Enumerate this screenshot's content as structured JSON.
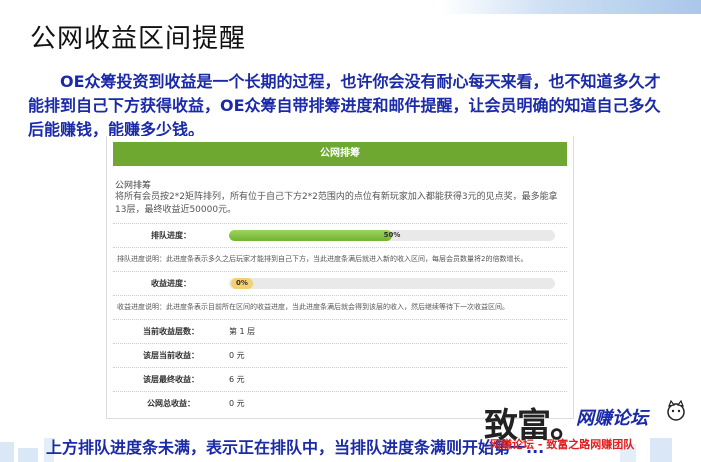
{
  "slide": {
    "title": "公网收益区间提醒",
    "intro": "OE众筹投资到收益是一个长期的过程，也许你会没有耐心每天来看，也不知道多久才能排到自己下方获得收益，OE众筹自带排筹进度和邮件提醒，让会员明确的知道自己多久后能赚钱，能赚多少钱。",
    "bottom_text": "上方排队进度条未满，表示正在排队中，当排队进度条满则开始第一..."
  },
  "panel": {
    "header": "公网排筹",
    "section_title": "公网排筹",
    "section_desc": "将所有会员按2*2矩阵排列，所有位于自己下方2*2范围内的点位有新玩家加入都能获得3元的见点奖，最多能拿13层，最终收益近50000元。",
    "queue_label": "排队进度：",
    "queue_progress_pct": 50,
    "queue_progress_text": "50%",
    "queue_note": "排队进度说明：此进度条表示多久之后玩家才能排到自己下方，当此进度条满后就进入新的收入区间，每层会员数量将2的倍数增长。",
    "income_label": "收益进度：",
    "income_progress_pct": 0,
    "income_progress_text": "0%",
    "income_note": "收益进度说明：此进度条表示目前所在区间的收益进度，当此进度条满后就会得到该层的收入，然后继续等待下一次收益区间。",
    "rows": [
      {
        "label": "当前收益层数：",
        "value": "第 1 层"
      },
      {
        "label": "该层当前收益：",
        "value": "0 元"
      },
      {
        "label": "该层最终收益：",
        "value": "6 元"
      },
      {
        "label": "公网总收益：",
        "value": "0 元"
      }
    ]
  },
  "watermark": {
    "big": "致富。",
    "small": "网赚论坛",
    "red": "网赚论坛 - 致富之路网赚团队"
  },
  "colors": {
    "header_green": "#6ea830",
    "text_blue": "#1a2aa8",
    "progress_green": "#6fb32f",
    "progress_badge": "#f4d070"
  }
}
